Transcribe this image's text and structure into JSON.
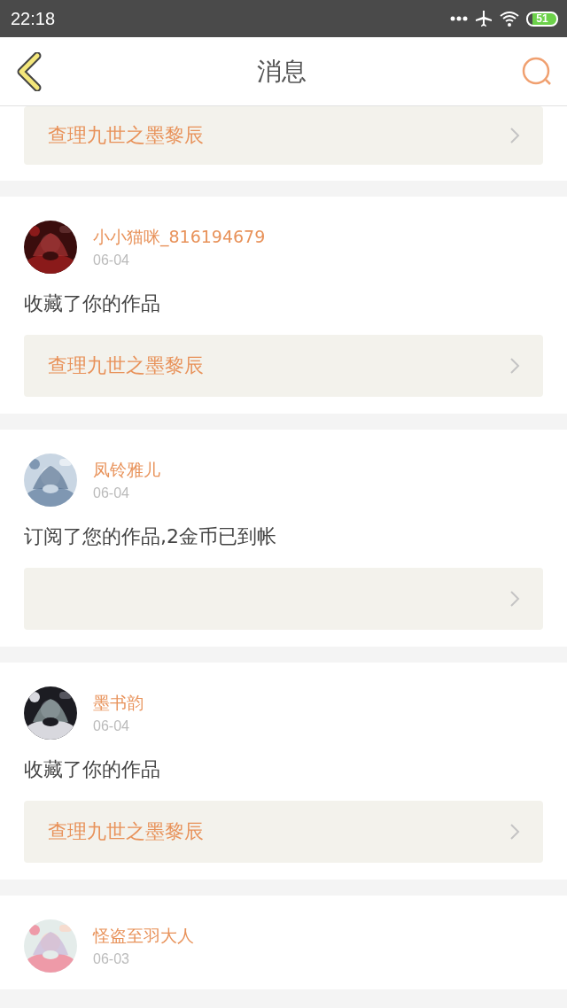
{
  "status_bar": {
    "time": "22:18",
    "battery": "51"
  },
  "header": {
    "title": "消息"
  },
  "top_partial": {
    "link": "查理九世之墨黎辰"
  },
  "messages": [
    {
      "kind": "linked",
      "user": "小小猫咪_816194679",
      "date": "06-04",
      "text": "收藏了你的作品",
      "link": "查理九世之墨黎辰"
    },
    {
      "kind": "linked",
      "user": "凤铃雅儿",
      "date": "06-04",
      "text": "订阅了您的作品,2金币已到帐"
    },
    {
      "kind": "linked",
      "user": "墨书韵",
      "date": "06-04",
      "text": "收藏了你的作品",
      "link": "查理九世之墨黎辰"
    },
    {
      "kind": "plain",
      "user": "怪盗至羽大人",
      "date": "06-03"
    }
  ]
}
